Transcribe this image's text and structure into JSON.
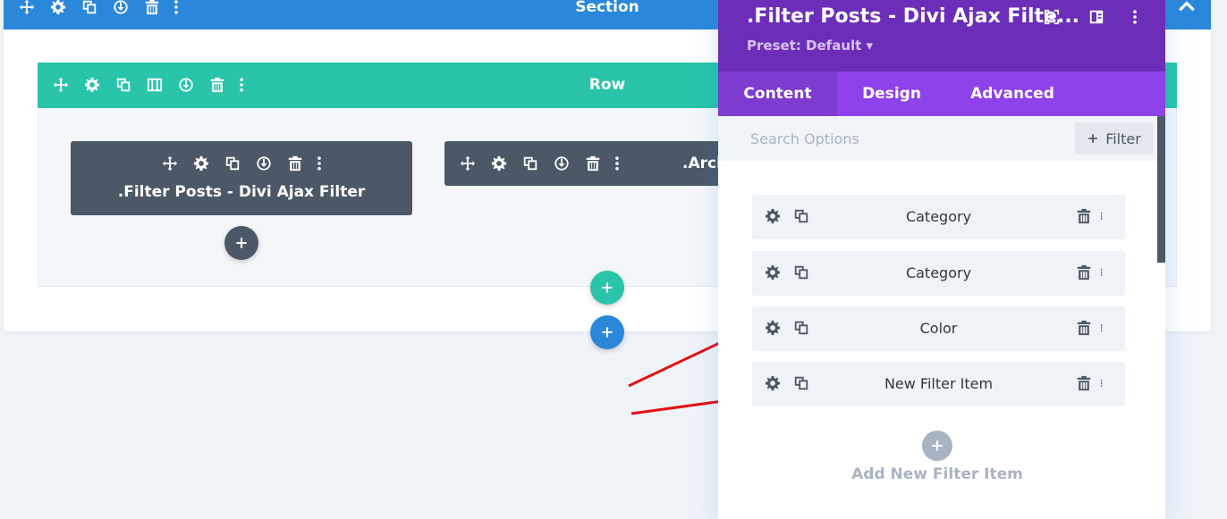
{
  "section": {
    "title": "Section",
    "color": "#2b87da"
  },
  "row": {
    "title": "Row",
    "color": "#29c4a9"
  },
  "modules": [
    {
      "title": ".Filter Posts - Divi Ajax Filter"
    },
    {
      "title": ".Arch"
    }
  ],
  "panel": {
    "title": ".Filter Posts - Divi Ajax Filte...",
    "preset": "Preset: Default ▾",
    "tabs": [
      {
        "label": "Content",
        "active": true
      },
      {
        "label": "Design",
        "active": false
      },
      {
        "label": "Advanced",
        "active": false
      }
    ],
    "search": {
      "placeholder": "Search Options",
      "value": ""
    },
    "filter_button": "Filter",
    "filter_items": [
      {
        "label": "Category"
      },
      {
        "label": "Category"
      },
      {
        "label": "Color"
      },
      {
        "label": "New Filter Item"
      }
    ],
    "add_new_label": "Add New Filter Item",
    "header_color": "#6c2eb9",
    "tabs_color": "#8e42ea"
  },
  "icons": {
    "module_toolbar": [
      "move-icon",
      "gear-icon",
      "duplicate-icon",
      "save-icon",
      "trash-icon",
      "more-icon"
    ],
    "row_toolbar": [
      "move-icon",
      "gear-icon",
      "duplicate-icon",
      "columns-icon",
      "save-icon",
      "trash-icon",
      "more-icon"
    ]
  }
}
